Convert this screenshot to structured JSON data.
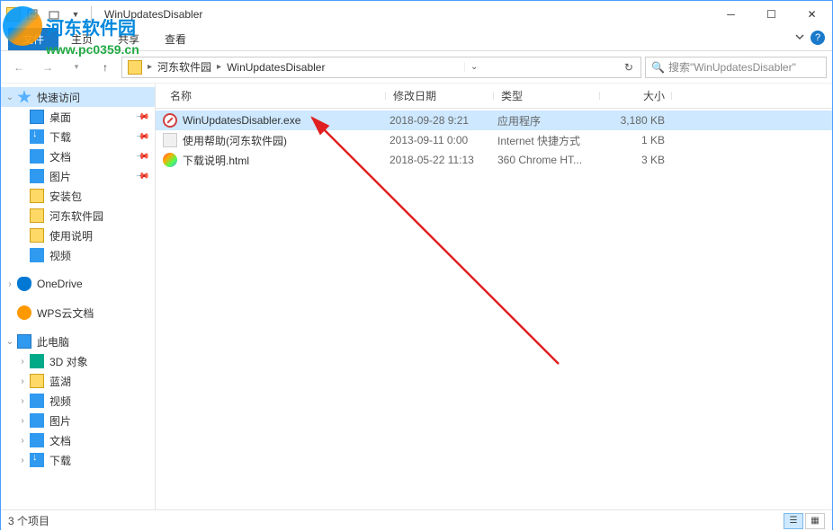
{
  "window": {
    "title": "WinUpdatesDisabler"
  },
  "ribbon": {
    "file": "文件",
    "tabs": [
      "主页",
      "共享",
      "查看"
    ]
  },
  "watermark": {
    "text": "河东软件园",
    "url": "www.pc0359.cn"
  },
  "breadcrumb": {
    "segments": [
      "河东软件园",
      "WinUpdatesDisabler"
    ]
  },
  "search": {
    "placeholder": "搜索\"WinUpdatesDisabler\""
  },
  "sidebar": {
    "quickAccess": "快速访问",
    "items": [
      {
        "label": "桌面",
        "icon": "ic-desktop",
        "pinned": true
      },
      {
        "label": "下载",
        "icon": "ic-download",
        "pinned": true
      },
      {
        "label": "文档",
        "icon": "ic-docs",
        "pinned": true
      },
      {
        "label": "图片",
        "icon": "ic-pics",
        "pinned": true
      },
      {
        "label": "安装包",
        "icon": "ic-folder",
        "pinned": false
      },
      {
        "label": "河东软件园",
        "icon": "ic-folder",
        "pinned": false
      },
      {
        "label": "使用说明",
        "icon": "ic-folder",
        "pinned": false
      },
      {
        "label": "视频",
        "icon": "ic-video",
        "pinned": false
      }
    ],
    "onedrive": "OneDrive",
    "wps": "WPS云文档",
    "thispc": "此电脑",
    "pcitems": [
      {
        "label": "3D 对象",
        "icon": "ic-3d"
      },
      {
        "label": "蓝湖",
        "icon": "ic-folder"
      },
      {
        "label": "视频",
        "icon": "ic-video"
      },
      {
        "label": "图片",
        "icon": "ic-pics"
      },
      {
        "label": "文档",
        "icon": "ic-docs"
      },
      {
        "label": "下载",
        "icon": "ic-download"
      }
    ]
  },
  "columns": {
    "name": "名称",
    "date": "修改日期",
    "type": "类型",
    "size": "大小"
  },
  "files": [
    {
      "name": "WinUpdatesDisabler.exe",
      "date": "2018-09-28 9:21",
      "type": "应用程序",
      "size": "3,180 KB",
      "icon": "ic-exe",
      "selected": true
    },
    {
      "name": "使用帮助(河东软件园)",
      "date": "2013-09-11 0:00",
      "type": "Internet 快捷方式",
      "size": "1 KB",
      "icon": "ic-url",
      "selected": false
    },
    {
      "name": "下载说明.html",
      "date": "2018-05-22 11:13",
      "type": "360 Chrome HT...",
      "size": "3 KB",
      "icon": "ic-html",
      "selected": false
    }
  ],
  "status": {
    "count": "3 个项目"
  }
}
